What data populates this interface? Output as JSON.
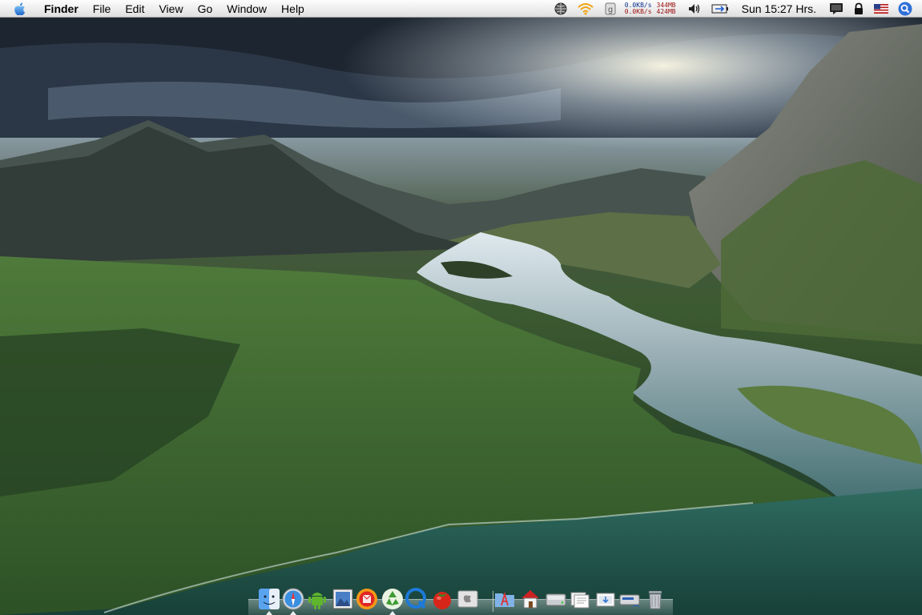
{
  "menubar": {
    "apple_icon": "apple-icon",
    "app_name": "Finder",
    "menus": [
      "File",
      "Edit",
      "View",
      "Go",
      "Window",
      "Help"
    ],
    "status": {
      "net_down": "0.0KB/s",
      "net_up": "0.0KB/s",
      "mem_top": "344MB",
      "mem_bottom": "424MB",
      "clock": "Sun 15:27 Hrs."
    }
  },
  "dock": {
    "items": [
      {
        "name": "finder-icon",
        "running": true
      },
      {
        "name": "safari-icon",
        "running": true
      },
      {
        "name": "android-icon",
        "running": false
      },
      {
        "name": "preview-icon",
        "running": false
      },
      {
        "name": "mail-app-icon",
        "running": false
      },
      {
        "name": "recycle-icon",
        "running": true
      },
      {
        "name": "quicktime-icon",
        "running": false
      },
      {
        "name": "tomato-icon",
        "running": false
      },
      {
        "name": "apple-box-icon",
        "running": false
      },
      {
        "name": "applications-folder-icon",
        "running": false
      },
      {
        "name": "home-folder-icon",
        "running": false
      },
      {
        "name": "hard-drive-icon",
        "running": false
      },
      {
        "name": "documents-stack-icon",
        "running": false
      },
      {
        "name": "downloads-stack-icon",
        "running": false
      },
      {
        "name": "network-drive-icon",
        "running": false
      },
      {
        "name": "trash-icon",
        "running": false
      }
    ]
  }
}
